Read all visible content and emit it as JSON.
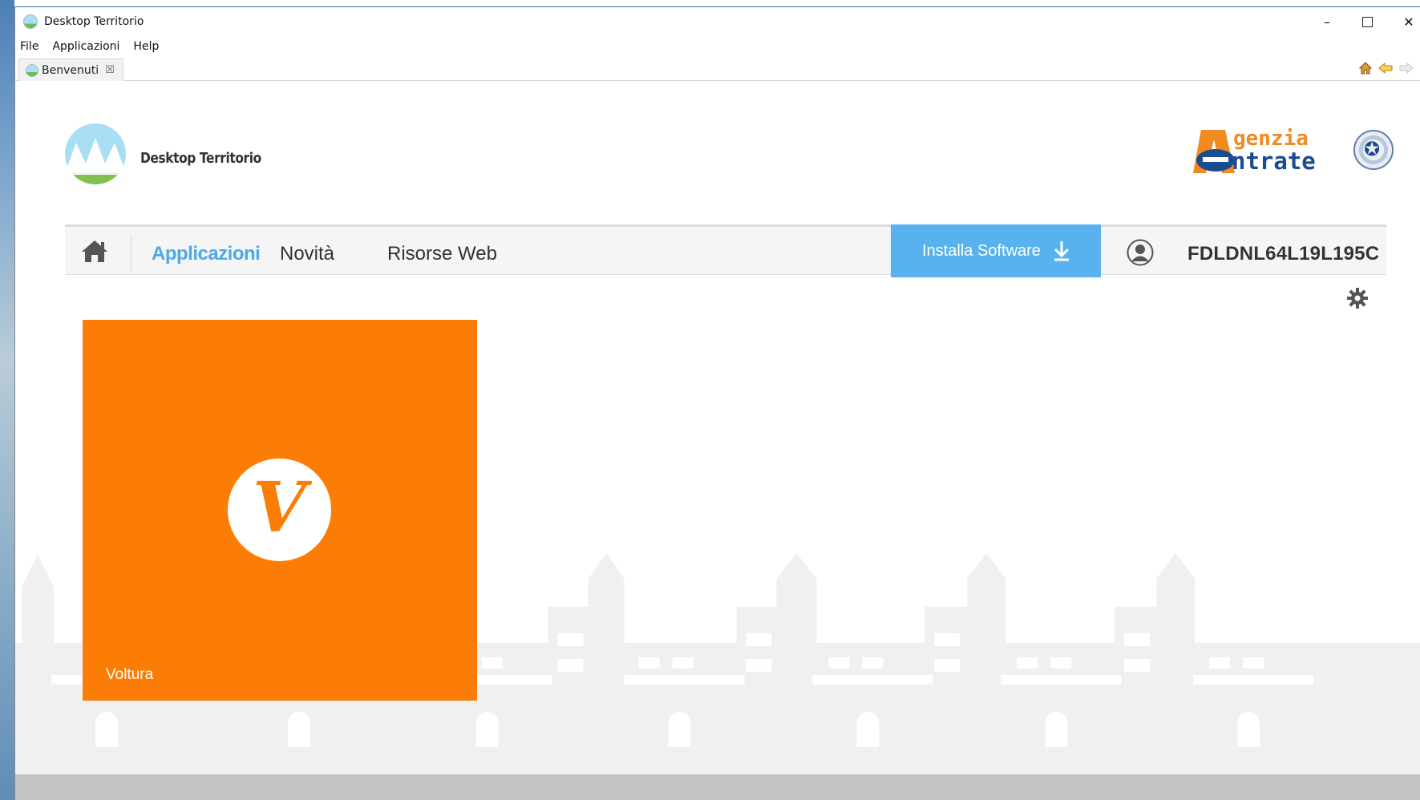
{
  "window": {
    "title": "Desktop Territorio",
    "minimize_glyph": "–",
    "close_glyph": "✕"
  },
  "menu": [
    "File",
    "Applicazioni",
    "Help"
  ],
  "tab": {
    "label": "Benvenuti",
    "close_glyph": "☒"
  },
  "toolbar_icons": [
    "home-icon",
    "back-arrow-icon",
    "forward-arrow-icon"
  ],
  "header": {
    "app_name": "Desktop Territorio",
    "agency_line1": "genzia",
    "agency_line2": "ntrate",
    "agency_initial": "A"
  },
  "nav": {
    "home_icon": "home-icon",
    "items": [
      "Applicazioni",
      "Novità",
      "Risorse Web"
    ],
    "active": "Applicazioni",
    "install_label": "Installa Software",
    "install_icon": "download-arrow-icon",
    "user_icon": "user-circle-icon",
    "user_code": "FDLDNL64L19L195C"
  },
  "settings_icon": "gear-icon",
  "tiles": [
    {
      "label": "Voltura",
      "letter": "V",
      "color": "#fb7d06"
    }
  ],
  "colors": {
    "accent_blue": "#58b2ef",
    "nav_active": "#4da8e8",
    "tile_orange": "#fb7d06",
    "agency_orange": "#f18a20",
    "agency_blue": "#1a4d8f"
  }
}
